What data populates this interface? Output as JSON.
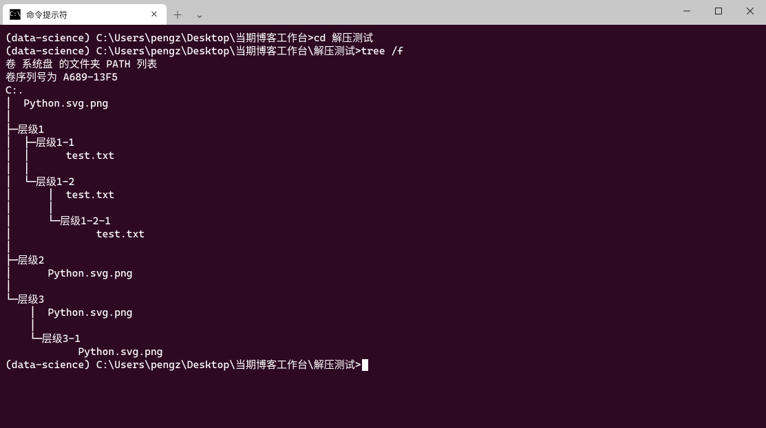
{
  "tab": {
    "icon_text": "C:\\",
    "title": "命令提示符",
    "close_glyph": "✕",
    "newtab_glyph": "＋",
    "dropdown_glyph": "⌄"
  },
  "window_controls": {
    "minimize": "—",
    "maximize": "□",
    "close": "✕"
  },
  "terminal": {
    "lines": [
      "",
      "(data-science) C:\\Users\\pengz\\Desktop\\当期博客工作台>cd 解压测试",
      "",
      "(data-science) C:\\Users\\pengz\\Desktop\\当期博客工作台\\解压测试>tree /f",
      "卷 系统盘 的文件夹 PATH 列表",
      "卷序列号为 A689-13F5",
      "C:.",
      "│  Python.svg.png",
      "│",
      "├─层级1",
      "│  ├─层级1-1",
      "│  │      test.txt",
      "│  │",
      "│  └─层级1-2",
      "│      │  test.txt",
      "│      │",
      "│      └─层级1-2-1",
      "│              test.txt",
      "│",
      "├─层级2",
      "│      Python.svg.png",
      "│",
      "└─层级3",
      "    │  Python.svg.png",
      "    │",
      "    └─层级3-1",
      "            Python.svg.png",
      "",
      ""
    ],
    "prompt": "(data-science) C:\\Users\\pengz\\Desktop\\当期博客工作台\\解压测试>"
  }
}
